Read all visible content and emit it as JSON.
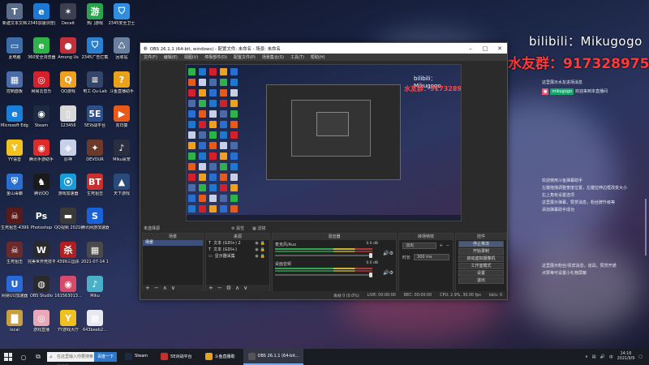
{
  "desktop_icons": [
    {
      "label": "新建文本文档",
      "glyph": "T",
      "color": "#5a6d8a",
      "col": 0,
      "row": 0
    },
    {
      "label": "2345加速浏览器",
      "glyph": "e",
      "color": "#1d78d2",
      "col": 1,
      "row": 0
    },
    {
      "label": "Deceit",
      "glyph": "✶",
      "color": "#3b3f4f",
      "col": 2,
      "row": 0
    },
    {
      "label": "热门游戏",
      "glyph": "游",
      "color": "#2aa34a",
      "col": 3,
      "row": 0
    },
    {
      "label": "2345安全卫士",
      "glyph": "⛉",
      "color": "#2f8ee0",
      "col": 4,
      "row": 0
    },
    {
      "label": "此电脑",
      "glyph": "▭",
      "color": "#3b6ea8",
      "col": 0,
      "row": 1
    },
    {
      "label": "360安全浏览器",
      "glyph": "e",
      "color": "#2db34a",
      "col": 1,
      "row": 1
    },
    {
      "label": "Among Us",
      "glyph": "●",
      "color": "#c4303a",
      "col": 2,
      "row": 1
    },
    {
      "label": "2345广告拦截",
      "glyph": "⛉",
      "color": "#2a7fd0",
      "col": 3,
      "row": 1
    },
    {
      "label": "回收站",
      "glyph": "♺",
      "color": "#6a7fa2",
      "col": 4,
      "row": 1
    },
    {
      "label": "控制面板",
      "glyph": "▦",
      "color": "#4a6aa8",
      "col": 0,
      "row": 2
    },
    {
      "label": "网易云音乐",
      "glyph": "◎",
      "color": "#d4202a",
      "col": 1,
      "row": 2
    },
    {
      "label": "QQ游戏",
      "glyph": "Q",
      "color": "#f0a020",
      "col": 2,
      "row": 2
    },
    {
      "label": "电工·Qu-Lab",
      "glyph": "≡",
      "color": "#34456a",
      "col": 3,
      "row": 2
    },
    {
      "label": "斗鱼直播助手",
      "glyph": "?",
      "color": "#e8a21c",
      "col": 4,
      "row": 2
    },
    {
      "label": "Microsoft Edge",
      "glyph": "e",
      "color": "#1a7fd8",
      "col": 0,
      "row": 3
    },
    {
      "label": "Steam",
      "glyph": "◉",
      "color": "#1e2a40",
      "col": 1,
      "row": 3
    },
    {
      "label": "123456",
      "glyph": "▯",
      "color": "#d8d8d8",
      "col": 2,
      "row": 3
    },
    {
      "label": "5E对战平台",
      "glyph": "5E",
      "color": "#2c4f8a",
      "col": 3,
      "row": 3
    },
    {
      "label": "向日葵",
      "glyph": "▶",
      "color": "#e85a1a",
      "col": 4,
      "row": 3
    },
    {
      "label": "YY语音",
      "glyph": "Y",
      "color": "#f2c21e",
      "col": 0,
      "row": 4
    },
    {
      "label": "腾讯手游助手",
      "glyph": "◉",
      "color": "#e02a2a",
      "col": 1,
      "row": 4
    },
    {
      "label": "原神",
      "glyph": "◈",
      "color": "#c8d0e8",
      "col": 2,
      "row": 4
    },
    {
      "label": "DEVOUR",
      "glyph": "✦",
      "color": "#6b3a2a",
      "col": 3,
      "row": 4
    },
    {
      "label": "Miku桌宠",
      "glyph": "♪",
      "color": "#2a2f40",
      "col": 4,
      "row": 4
    },
    {
      "label": "金山毒霸",
      "glyph": "⛨",
      "color": "#2a6ed0",
      "col": 0,
      "row": 5
    },
    {
      "label": "腾讯QQ",
      "glyph": "♞",
      "color": "#1a1a1a",
      "col": 1,
      "row": 5
    },
    {
      "label": "游戏加速器",
      "glyph": "⦿",
      "color": "#1a9ad8",
      "col": 2,
      "row": 5
    },
    {
      "label": "生死狙击",
      "glyph": "BT",
      "color": "#c83030",
      "col": 3,
      "row": 5
    },
    {
      "label": "天下游戏",
      "glyph": "▲",
      "color": "#2a4a7a",
      "col": 4,
      "row": 5
    },
    {
      "label": "生死狙击-4399",
      "glyph": "☠",
      "color": "#5a1a1a",
      "col": 0,
      "row": 6
    },
    {
      "label": "Photoshop",
      "glyph": "Ps",
      "color": "#1a2a4a",
      "col": 1,
      "row": 6
    },
    {
      "label": "QQ视频 20210118",
      "glyph": "▬",
      "color": "#3a3a3a",
      "col": 2,
      "row": 6
    },
    {
      "label": "腾讯网游加速器",
      "glyph": "S",
      "color": "#1a62d8",
      "col": 3,
      "row": 6
    },
    {
      "label": "生死狙击",
      "glyph": "☠",
      "color": "#6a2a2a",
      "col": 0,
      "row": 7
    },
    {
      "label": "完美世界竞技平台",
      "glyph": "W",
      "color": "#2a2a2a",
      "col": 1,
      "row": 7
    },
    {
      "label": "4399三国杀",
      "glyph": "杀",
      "color": "#b02020",
      "col": 2,
      "row": 7
    },
    {
      "label": "2021-07-14 19-32-02",
      "glyph": "▦",
      "color": "#4a4a4a",
      "col": 3,
      "row": 7
    },
    {
      "label": "网易UU加速器",
      "glyph": "U",
      "color": "#2a6ad8",
      "col": 0,
      "row": 8
    },
    {
      "label": "OBS Studio",
      "glyph": "◍",
      "color": "#2a2a2a",
      "col": 1,
      "row": 8
    },
    {
      "label": "161563013...",
      "glyph": "◉",
      "color": "#d84a6a",
      "col": 2,
      "row": 8
    },
    {
      "label": "Miku",
      "glyph": "♪",
      "color": "#4ab0c8",
      "col": 3,
      "row": 8
    },
    {
      "label": "local",
      "glyph": "▇",
      "color": "#c8a040",
      "col": 0,
      "row": 9
    },
    {
      "label": "游戏直播",
      "glyph": "◎",
      "color": "#e8a8b8",
      "col": 1,
      "row": 9
    },
    {
      "label": "YY游戏大厅",
      "glyph": "Y",
      "color": "#f0c020",
      "col": 2,
      "row": 9
    },
    {
      "label": "643beeb2...",
      "glyph": "▦",
      "color": "#e8e8f0",
      "col": 3,
      "row": 9
    }
  ],
  "overlay": {
    "bilibili": "bilibili：Mikugogo",
    "fans_group": "水友群：917328975"
  },
  "chat": {
    "line1": "这里展示水友进场消息",
    "user_name": "mikugogo",
    "user_msg": "欢迎来到本直播间",
    "help1": "欢迎使用斗鱼弹幕助手",
    "help2": "左键拖拽调整宽度位置，左键拉伸边框改变大小",
    "help3": "右上角有设置选项",
    "help4": "这里展示弹幕，赞赏消息，粉丝牌升级等",
    "help5": "添加弹幕助手成功",
    "gift1": "这里展示粉丝/贵宾消息，道具，赞赏开通",
    "gift2": "点赞等可设置小礼物屏蔽"
  },
  "obs": {
    "title": "OBS 26.1.1 (64-bit, windows) - 配置文件: 未命名 - 场景: 未命名",
    "menu": [
      "文件(F)",
      "编辑(E)",
      "视图(V)",
      "停靠部件(D)",
      "配置文件(P)",
      "场景集合(S)",
      "工具(T)",
      "帮助(H)"
    ],
    "no_source": "未选择源",
    "tabs": [
      "⚙ 属性",
      "▦ 滤镜"
    ],
    "docks": {
      "scenes": "场景",
      "sources": "来源",
      "mixer": "混音器",
      "transitions": "转场特效",
      "controls": "控件"
    },
    "scene_items": [
      "场景"
    ],
    "sources_items": [
      {
        "name": "文本 (GDI+) 2",
        "glyph": "T"
      },
      {
        "name": "文本 (GDI+)",
        "glyph": "T"
      },
      {
        "name": "显示器采集",
        "glyph": "▭"
      }
    ],
    "mixer_items": [
      {
        "name": "麦克风/Aux",
        "db": "0.0 dB"
      },
      {
        "name": "桌面音频",
        "db": "0.0 dB"
      }
    ],
    "transition": "淡出",
    "duration_label": "时长",
    "duration_value": "300 ms",
    "controls": [
      "停止推流",
      "开始录制",
      "启动虚拟摄像机",
      "工作室模式",
      "设置",
      "退出"
    ],
    "status": {
      "dropped": "丢帧 0 (0.0%)",
      "live": "LIVE: 00:00:00",
      "rec": "REC: 00:00:00",
      "cpu": "CPU: 2.9%, 30.00 fps",
      "kbps": "kb/s: 0"
    }
  },
  "taskbar": {
    "search_placeholder": "在这里输入你要搜索的内容",
    "search_btn": "百度一下",
    "apps": [
      {
        "label": "Steam",
        "color": "#1e2a40",
        "active": false
      },
      {
        "label": "5E对战平台",
        "color": "#c83030",
        "active": false
      },
      {
        "label": "斗鱼直播助",
        "color": "#e8a21c",
        "active": false
      },
      {
        "label": "OBS 26.1.1 (64-bit...",
        "color": "#555",
        "active": true
      }
    ],
    "time": "14:16",
    "date": "2021/9/9",
    "lang": "中"
  }
}
